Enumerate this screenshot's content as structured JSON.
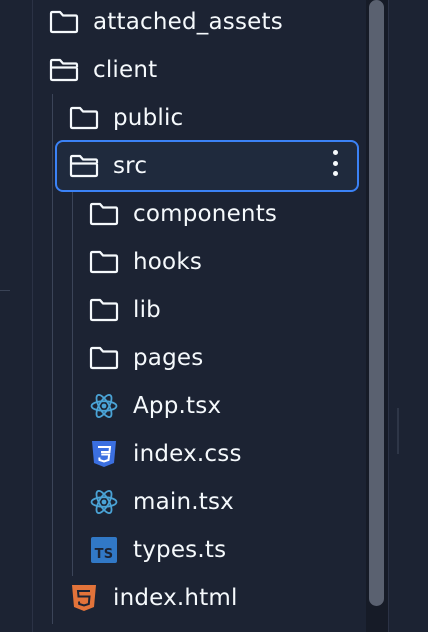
{
  "file_tree": {
    "items": [
      {
        "label": "attached_assets",
        "icon": "folder-icon"
      },
      {
        "label": "client",
        "icon": "folder-open-icon"
      },
      {
        "label": "public",
        "icon": "folder-icon"
      },
      {
        "label": "src",
        "icon": "folder-open-icon",
        "selected": true
      },
      {
        "label": "components",
        "icon": "folder-icon"
      },
      {
        "label": "hooks",
        "icon": "folder-icon"
      },
      {
        "label": "lib",
        "icon": "folder-icon"
      },
      {
        "label": "pages",
        "icon": "folder-icon"
      },
      {
        "label": "App.tsx",
        "icon": "react-icon"
      },
      {
        "label": "index.css",
        "icon": "css-icon"
      },
      {
        "label": "main.tsx",
        "icon": "react-icon"
      },
      {
        "label": "types.ts",
        "icon": "typescript-icon"
      },
      {
        "label": "index.html",
        "icon": "html-icon"
      }
    ]
  },
  "colors": {
    "background": "#1c2333",
    "text": "#f5f9fc",
    "selection_border": "#3b82f6",
    "react": "#4aa3d6",
    "css": "#3b6fe0",
    "typescript": "#3178c6",
    "html": "#e2733a"
  }
}
